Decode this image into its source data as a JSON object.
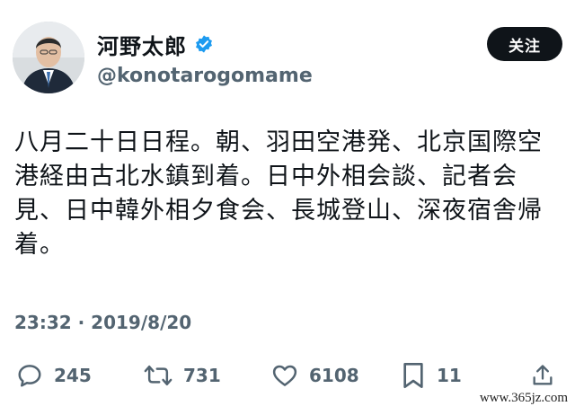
{
  "user": {
    "display_name": "河野太郎",
    "handle": "@konotarogomame",
    "verified": true,
    "avatar_icon": "profile-photo"
  },
  "follow_button": {
    "label": "关注"
  },
  "tweet": {
    "text": "八月二十日日程。朝、羽田空港発、北京国際空港経由古北水鎮到着。日中外相会談、記者会見、日中韓外相夕食会、長城登山、深夜宿舎帰着。",
    "timestamp": "23:32 · 2019/8/20"
  },
  "actions": {
    "reply": {
      "icon": "reply-icon",
      "count": "245"
    },
    "retweet": {
      "icon": "retweet-icon",
      "count": "731"
    },
    "like": {
      "icon": "heart-icon",
      "count": "6108"
    },
    "bookmark": {
      "icon": "bookmark-icon",
      "count": "11"
    },
    "share": {
      "icon": "share-icon"
    }
  },
  "watermark": {
    "text": "www.365jz.com"
  },
  "colors": {
    "text_primary": "#0f1419",
    "text_secondary": "#536471",
    "verified_blue": "#1d9bf0",
    "button_bg": "#0f1419"
  }
}
